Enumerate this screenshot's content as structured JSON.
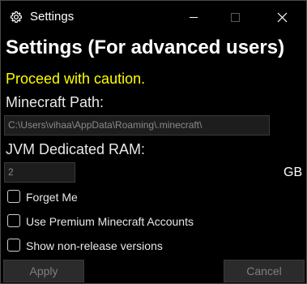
{
  "window": {
    "title": "Settings",
    "icon": "gear-icon"
  },
  "header": {
    "title": "Settings (For advanced users)",
    "caution": "Proceed with caution."
  },
  "minecraft_path": {
    "label": "Minecraft Path:",
    "value": "C:\\Users\\vihaa\\AppData\\Roaming\\.minecraft\\"
  },
  "ram": {
    "label": "JVM Dedicated RAM:",
    "value": "2",
    "unit": "GB"
  },
  "options": [
    {
      "label": "Forget Me",
      "checked": false
    },
    {
      "label": "Use Premium Minecraft Accounts",
      "checked": false
    },
    {
      "label": "Show non-release versions",
      "checked": false
    }
  ],
  "buttons": {
    "apply": "Apply",
    "cancel": "Cancel"
  },
  "colors": {
    "background": "#000000",
    "caution": "#ffff00",
    "text": "#ffffff"
  }
}
